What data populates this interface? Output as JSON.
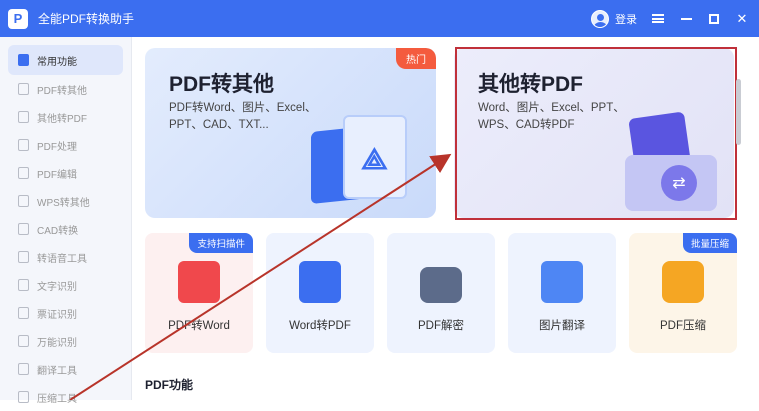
{
  "app": {
    "title": "全能PDF转换助手",
    "logo_letter": "P",
    "login_label": "登录"
  },
  "sidebar": {
    "items": [
      {
        "label": "常用功能",
        "active": true
      },
      {
        "label": "PDF转其他"
      },
      {
        "label": "其他转PDF"
      },
      {
        "label": "PDF处理"
      },
      {
        "label": "PDF编辑"
      },
      {
        "label": "WPS转其他"
      },
      {
        "label": "CAD转换"
      },
      {
        "label": "转语音工具"
      },
      {
        "label": "文字识别"
      },
      {
        "label": "票证识别"
      },
      {
        "label": "万能识别"
      },
      {
        "label": "翻译工具"
      },
      {
        "label": "压缩工具"
      }
    ]
  },
  "cards": {
    "pdf_to_other": {
      "title": "PDF转其他",
      "desc": "PDF转Word、图片、Excel、\nPPT、CAD、TXT...",
      "badge": "热门"
    },
    "other_to_pdf": {
      "title": "其他转PDF",
      "desc": "Word、图片、Excel、PPT、\nWPS、CAD转PDF"
    }
  },
  "tiles": [
    {
      "label": "PDF转Word",
      "badge": "支持扫描件",
      "color": "#fdf0f0"
    },
    {
      "label": "Word转PDF",
      "badge": "",
      "color": "#eef3fe"
    },
    {
      "label": "PDF解密",
      "badge": "",
      "color": "#eef3fe"
    },
    {
      "label": "图片翻译",
      "badge": "",
      "color": "#eef3fe"
    },
    {
      "label": "PDF压缩",
      "badge": "批量压缩",
      "color": "#fdf5e8"
    }
  ],
  "section": {
    "title": "PDF功能"
  },
  "colors": {
    "accent": "#3b6ef0",
    "hot": "#f45b3e",
    "highlight": "#c0303a"
  }
}
